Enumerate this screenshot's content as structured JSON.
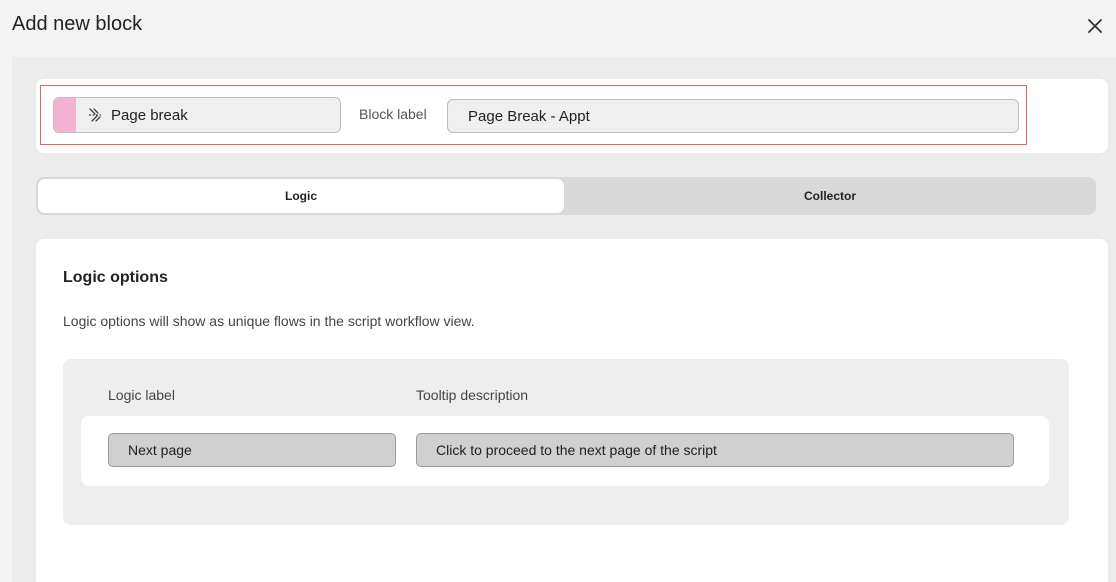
{
  "dialog": {
    "title": "Add new block",
    "close_icon": "close-icon"
  },
  "block": {
    "type_label": "Page break",
    "type_icon": "page-break-icon",
    "type_color": "#f5b1d1",
    "block_label_caption": "Block label",
    "block_label_value": "Page Break - Appt"
  },
  "tabs": [
    {
      "label": "Logic",
      "active": true
    },
    {
      "label": "Collector",
      "active": false
    }
  ],
  "logic": {
    "title": "Logic options",
    "description": "Logic options will show as unique flows in the script workflow view.",
    "columns": [
      "Logic label",
      "Tooltip description"
    ],
    "options": [
      {
        "label": "Next page",
        "tooltip": "Click to proceed to the next page of the script"
      }
    ]
  },
  "colors": {
    "highlight_border": "#e0666a"
  }
}
